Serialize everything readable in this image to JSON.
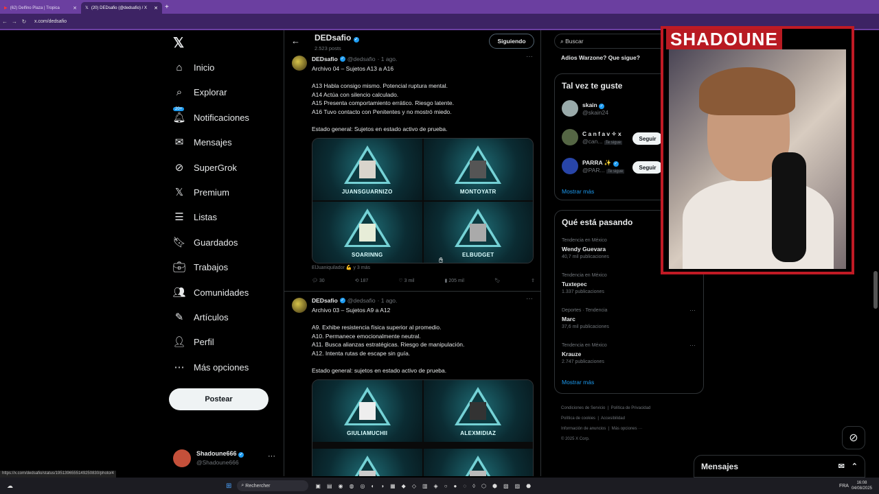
{
  "browser": {
    "tabs": [
      {
        "label": "(62) Delfino Plaza | Tropica",
        "active": false
      },
      {
        "label": "(20) DEDsafio (@dedsafio) / X",
        "active": true
      }
    ],
    "url": "x.com/dedsafio",
    "status_url": "https://x.com/dedsafio/status/1951396555149250830/photo/4"
  },
  "sidebar": {
    "items": [
      {
        "label": "Inicio",
        "icon": "home-icon"
      },
      {
        "label": "Explorar",
        "icon": "search-icon"
      },
      {
        "label": "Notificaciones",
        "icon": "bell-icon",
        "badge": "20+"
      },
      {
        "label": "Mensajes",
        "icon": "mail-icon"
      },
      {
        "label": "SuperGrok",
        "icon": "grok-icon"
      },
      {
        "label": "Premium",
        "icon": "x-logo-icon"
      },
      {
        "label": "Listas",
        "icon": "list-icon"
      },
      {
        "label": "Guardados",
        "icon": "bookmark-icon"
      },
      {
        "label": "Trabajos",
        "icon": "briefcase-icon"
      },
      {
        "label": "Comunidades",
        "icon": "people-icon"
      },
      {
        "label": "Artículos",
        "icon": "article-icon"
      },
      {
        "label": "Perfil",
        "icon": "person-icon"
      },
      {
        "label": "Más opciones",
        "icon": "more-icon"
      }
    ],
    "post_label": "Postear",
    "account": {
      "name": "Shadoune666",
      "handle": "@Shadoune666"
    }
  },
  "profile_header": {
    "name": "DEDsafio",
    "posts": "2.523 posts",
    "follow_label": "Siguiendo"
  },
  "tweets": [
    {
      "name": "DEDsafio",
      "handle": "@dedsafio",
      "date": "· 1 ago.",
      "title": "Archivo 04 – Sujetos A13 a A16",
      "body": "A13 Habla consigo mismo. Potencial ruptura mental.\nA14 Actúa con silencio calculado.\nA15 Presenta comportamiento errático. Riesgo latente.\nA16 Tuvo contacto con Penitentes y no mostró miedo.\n\nEstado general: Sujetos en estado activo de prueba.",
      "cards": [
        "JUANSGUARNIZO",
        "MONTOYATR",
        "SOARINNG",
        "ELBUDGET"
      ],
      "tagged": "ElJuaniquilador 💪 y 3 más",
      "replies": "30",
      "reposts": "187",
      "likes": "3 mil",
      "views": "205 mil"
    },
    {
      "name": "DEDsafio",
      "handle": "@dedsafio",
      "date": "· 1 ago.",
      "title": "Archivo 03 – Sujetos A9 a A12",
      "body": "A9. Exhibe resistencia física superior al promedio.\nA10. Permanece emocionalmente neutral.\nA11. Busca alianzas estratégicas. Riesgo de manipulación.\nA12. Intenta rutas de escape sin guía.\n\nEstado general: sujetos en estado activo de prueba.",
      "cards": [
        "GIULIAMUCHII",
        "ALEXMIDIAZ",
        "",
        ""
      ]
    }
  ],
  "right": {
    "search_placeholder": "Buscar",
    "top_trend": "Adios Warzone? Que sigue?",
    "suggest_title": "Tal vez te guste",
    "suggestions": [
      {
        "name": "skain",
        "handle": "@skain24"
      },
      {
        "name": "C a n f a v ✧ x",
        "handle": "@can...",
        "tag": "Te sigue",
        "follow": "Seguir"
      },
      {
        "name": "PARRA ✨",
        "handle": "@PAR...",
        "tag": "Te sigue",
        "follow": "Seguir"
      }
    ],
    "show_more": "Mostrar más",
    "trends_title": "Qué está pasando",
    "trends": [
      {
        "context": "Tendencia en México",
        "name": "Wendy Guevara",
        "count": "40,7 mil publicaciones"
      },
      {
        "context": "Tendencia en México",
        "name": "Tuxtepec",
        "count": "1.337 publicaciones"
      },
      {
        "context": "Deportes · Tendencia",
        "name": "Marc",
        "count": "37,6 mil publicaciones"
      },
      {
        "context": "Tendencia en México",
        "name": "Krauze",
        "count": "2.747 publicaciones"
      }
    ],
    "footer": [
      "Condiciones de Servicio",
      "Política de Privacidad",
      "Política de cookies",
      "Accesibilidad",
      "Información de anuncios",
      "Más opciones ···",
      "© 2025 X Corp."
    ]
  },
  "overlay": {
    "streamer": "SHADOUNE"
  },
  "messages_label": "Mensajes",
  "taskbar": {
    "search": "Rechercher",
    "lang": "FRA",
    "time": "16:08",
    "date": "04/08/2025"
  }
}
